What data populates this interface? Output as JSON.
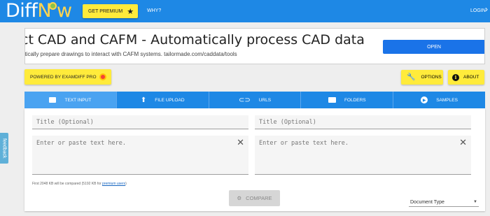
{
  "header": {
    "logo_part1": "Diff",
    "logo_part2": "N",
    "logo_part3": "w",
    "premium_label": "GET PREMIUM",
    "why_label": "WHY?",
    "login_label": "LOGIN"
  },
  "ad": {
    "title": "ct CAD and CAFM - Automatically process CAD data",
    "subtitle": "atically prepare drawings to interact with CAFM systems. tailormade.com/caddata/tools",
    "open_label": "OPEN"
  },
  "toolbar": {
    "powered_label": "POWERED BY EXAMDIFF PRO",
    "options_label": "OPTIONS",
    "about_label": "ABOUT"
  },
  "tabs": [
    {
      "label": "TEXT INPUT",
      "icon": "chat-icon",
      "active": true
    },
    {
      "label": "FILE UPLOAD",
      "icon": "upload-icon",
      "active": false
    },
    {
      "label": "URLS",
      "icon": "link-icon",
      "active": false
    },
    {
      "label": "FOLDERS",
      "icon": "folder-icon",
      "active": false
    },
    {
      "label": "SAMPLES",
      "icon": "play-icon",
      "active": false
    }
  ],
  "editor": {
    "title_placeholder_left": "Title (Optional)",
    "title_placeholder_right": "Title (Optional)",
    "text_placeholder_left": "Enter or paste text here.",
    "text_placeholder_right": "Enter or paste text here.",
    "note_text": "First 2048 KB will be compared (5192 KB for ",
    "note_link": "premium users",
    "note_end": ")",
    "compare_label": "COMPARE",
    "doc_type_label": "Document Type"
  },
  "feedback_label": "feedback",
  "colors": {
    "primary": "#1e88e5",
    "accent": "#ffeb3b",
    "active_tab": "#4aa3f1"
  }
}
